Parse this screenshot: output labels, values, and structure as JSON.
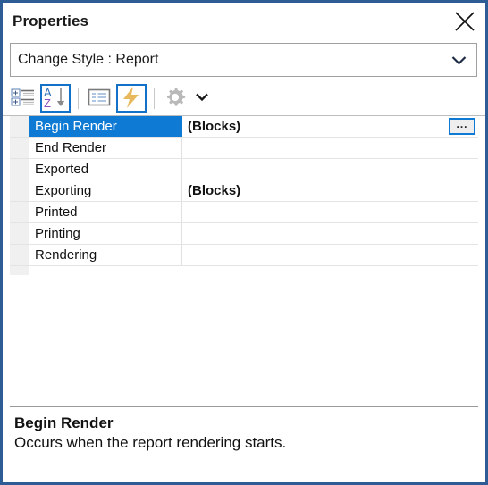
{
  "window": {
    "title": "Properties",
    "close_icon": "close-icon",
    "border_color": "#2e5c94"
  },
  "object_selector": {
    "value": "Change Style : Report",
    "arrow_icon": "chevron-down-icon"
  },
  "toolbar": {
    "buttons": [
      {
        "name": "categorized-button",
        "icon": "categorized-icon",
        "active": false
      },
      {
        "name": "alphabetical-sort-button",
        "icon": "sort-az-icon",
        "active": true
      },
      {
        "name": "properties-button",
        "icon": "properties-list-icon",
        "active": false
      },
      {
        "name": "events-button",
        "icon": "lightning-bolt-icon",
        "active": true
      },
      {
        "name": "settings-button",
        "icon": "gear-icon",
        "active": false
      }
    ],
    "overflow_icon": "chevron-down-icon"
  },
  "grid": {
    "rows": [
      {
        "name": "Begin Render",
        "value": "(Blocks)",
        "selected": true,
        "has_ellipsis": true
      },
      {
        "name": "End Render",
        "value": "",
        "selected": false,
        "has_ellipsis": false
      },
      {
        "name": "Exported",
        "value": "",
        "selected": false,
        "has_ellipsis": false
      },
      {
        "name": "Exporting",
        "value": "(Blocks)",
        "selected": false,
        "has_ellipsis": false
      },
      {
        "name": "Printed",
        "value": "",
        "selected": false,
        "has_ellipsis": false
      },
      {
        "name": "Printing",
        "value": "",
        "selected": false,
        "has_ellipsis": false
      },
      {
        "name": "Rendering",
        "value": "",
        "selected": false,
        "has_ellipsis": false
      }
    ],
    "ellipsis_label": "...",
    "selection_color": "#0f7ad4"
  },
  "description": {
    "title": "Begin Render",
    "text": "Occurs when the report rendering starts."
  }
}
